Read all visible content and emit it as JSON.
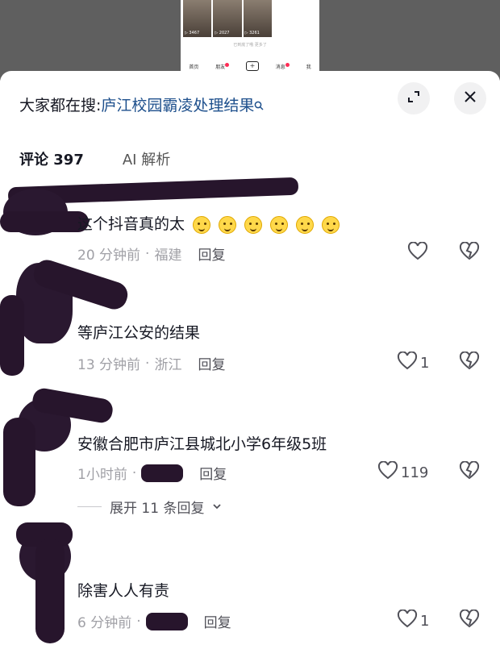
{
  "background_preview": {
    "thumbs": [
      "▷ 3467",
      "▷ 2027",
      "▷ 3261"
    ],
    "caption": "已到底了哦 更多了",
    "nav": [
      "首页",
      "朋友",
      "+",
      "消息",
      "我"
    ]
  },
  "search": {
    "prefix": "大家都在搜:",
    "term": "庐江校园霸凌处理结果",
    "icon": "search-icon"
  },
  "tabs": {
    "comments_label": "评论",
    "comments_count": "397",
    "ai_label": "AI 解析"
  },
  "comments": [
    {
      "text": "这个抖音真的太",
      "emoji_count": 6,
      "time": "20 分钟前",
      "location": "福建",
      "reply": "回复",
      "likes": ""
    },
    {
      "text": "等庐江公安的结果",
      "time": "13 分钟前",
      "location": "浙江",
      "reply": "回复",
      "likes": "1"
    },
    {
      "text": "安徽合肥市庐江县城北小学6年级5班",
      "time": "1小时前",
      "location": "",
      "reply": "回复",
      "likes": "119",
      "expand": "展开 11 条回复"
    },
    {
      "text": "除害人人有责",
      "time": "6 分钟前",
      "location": "",
      "reply": "回复",
      "likes": "1"
    }
  ],
  "colors": {
    "accent_link": "#1d4f8c",
    "muted": "#a0a0a6",
    "redaction": "#27152c"
  }
}
